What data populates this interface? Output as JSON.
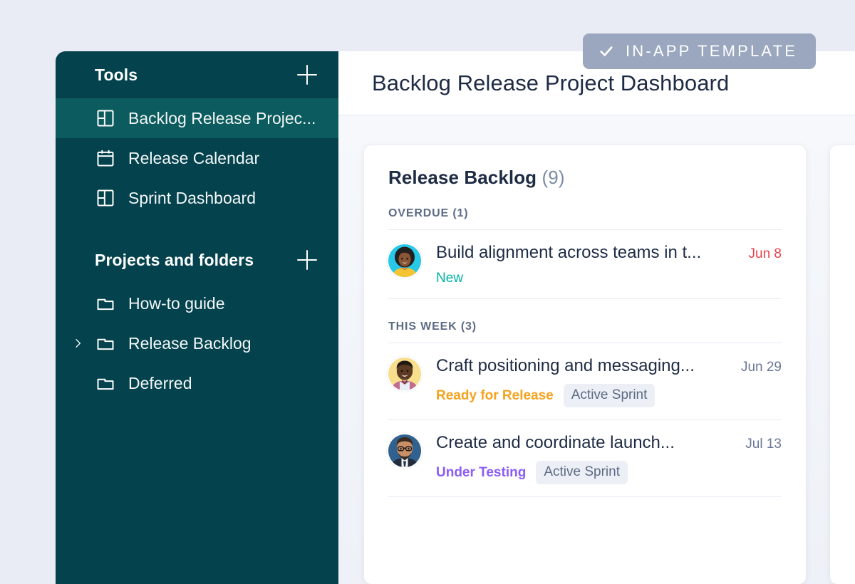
{
  "badge": {
    "label": "IN-APP TEMPLATE",
    "icon": "check-icon",
    "bg_color": "#9aa7bf"
  },
  "sidebar": {
    "bg_color": "#04424d",
    "active_bg_color": "#0c5b5e",
    "sections": [
      {
        "title": "Tools",
        "add_icon": "plus-icon",
        "items": [
          {
            "label": "Backlog Release Projec...",
            "icon": "dashboard-icon",
            "active": true,
            "expandable": false
          },
          {
            "label": "Release Calendar",
            "icon": "calendar-icon",
            "active": false,
            "expandable": false
          },
          {
            "label": "Sprint Dashboard",
            "icon": "dashboard-icon",
            "active": false,
            "expandable": false
          }
        ]
      },
      {
        "title": "Projects and folders",
        "add_icon": "plus-icon",
        "items": [
          {
            "label": "How-to guide",
            "icon": "folder-icon",
            "active": false,
            "expandable": false
          },
          {
            "label": "Release Backlog",
            "icon": "folder-icon",
            "active": false,
            "expandable": true
          },
          {
            "label": "Deferred",
            "icon": "folder-icon",
            "active": false,
            "expandable": false
          }
        ]
      }
    ]
  },
  "header": {
    "title": "Backlog Release Project Dashboard"
  },
  "card": {
    "title": "Release Backlog",
    "count": "(9)",
    "groups": [
      {
        "label": "OVERDUE (1)",
        "tasks": [
          {
            "name": "Build alignment across teams in t...",
            "date": "Jun 8",
            "date_overdue": true,
            "status": "New",
            "status_color": "#00b3a4",
            "status_bold": false,
            "tag": "",
            "avatar": "avatar-woman-curly-hair"
          }
        ]
      },
      {
        "label": "THIS WEEK (3)",
        "tasks": [
          {
            "name": "Craft positioning and messaging...",
            "date": "Jun 29",
            "date_overdue": false,
            "status": "Ready for Release",
            "status_color": "#f5a21f",
            "status_bold": true,
            "tag": "Active Sprint",
            "avatar": "avatar-man-smiling"
          },
          {
            "name": "Create and coordinate launch...",
            "date": "Jul 13",
            "date_overdue": false,
            "status": "Under Testing",
            "status_color": "#8b5cf6",
            "status_bold": true,
            "tag": "Active Sprint",
            "avatar": "avatar-man-glasses"
          }
        ]
      }
    ]
  }
}
